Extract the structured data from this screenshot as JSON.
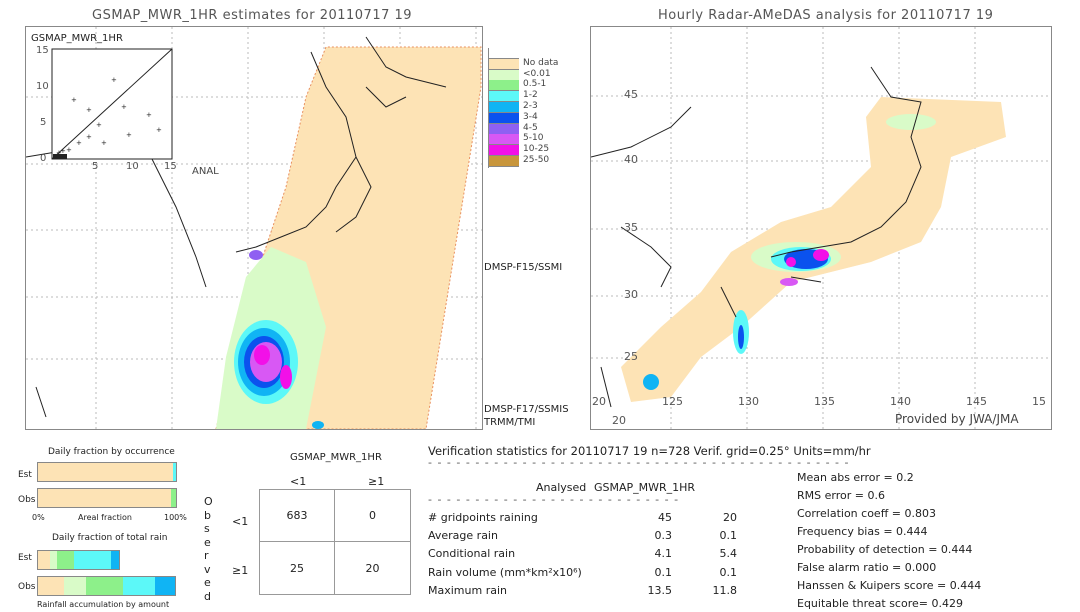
{
  "left_panel": {
    "title": "GSMAP_MWR_1HR estimates for 20110717 19",
    "inset_title": "GSMAP_MWR_1HR",
    "inset_xlabel": "ANAL",
    "inset_ticks": [
      "0",
      "5",
      "10",
      "15"
    ],
    "sensor_labels": [
      "DMSP-F15/SSMI",
      "DMSP-F17/SSMIS",
      "TRMM/TMI"
    ]
  },
  "right_panel": {
    "title": "Hourly Radar-AMeDAS analysis for 20110717 19",
    "lon_ticks": [
      "125",
      "130",
      "135",
      "140",
      "145",
      "15"
    ],
    "lat_ticks": [
      "45",
      "40",
      "35",
      "30",
      "25",
      "20"
    ],
    "corner_lon": "20",
    "corner_lat": "20",
    "credit": "Provided by JWA/JMA"
  },
  "legend": [
    {
      "label": "",
      "color": "#ffffff"
    },
    {
      "label": "No data",
      "color": "#fde3b5"
    },
    {
      "label": "<0.01",
      "color": "#d9fbc8"
    },
    {
      "label": "0.5-1",
      "color": "#8df08a"
    },
    {
      "label": "1-2",
      "color": "#5cf8f8"
    },
    {
      "label": "2-3",
      "color": "#10b4f4"
    },
    {
      "label": "3-4",
      "color": "#0b52ee"
    },
    {
      "label": "4-5",
      "color": "#8f60f2"
    },
    {
      "label": "5-10",
      "color": "#d858f4"
    },
    {
      "label": "10-25",
      "color": "#f210e8"
    },
    {
      "label": "25-50",
      "color": "#c8963c"
    }
  ],
  "occurrence": {
    "title": "Daily fraction by occurrence",
    "est_label": "Est",
    "obs_label": "Obs",
    "x_left": "0%",
    "x_mid": "Areal fraction",
    "x_right": "100%"
  },
  "total_rain": {
    "title": "Daily fraction of total rain",
    "est_label": "Est",
    "obs_label": "Obs",
    "caption": "Rainfall accumulation by amount"
  },
  "contingency": {
    "title": "GSMAP_MWR_1HR",
    "col_labels": [
      "<1",
      "≥1"
    ],
    "row_labels": [
      "<1",
      "≥1"
    ],
    "side_label": "Observed",
    "cells": [
      [
        "683",
        "0"
      ],
      [
        "25",
        "20"
      ]
    ]
  },
  "stats": {
    "header": "Verification statistics for 20110717 19   n=728   Verif. grid=0.25°   Units=mm/hr",
    "col1": "Analysed",
    "col2": "GSMAP_MWR_1HR",
    "rows": [
      {
        "label": "# gridpoints raining",
        "a": "45",
        "b": "20"
      },
      {
        "label": "Average rain",
        "a": "0.3",
        "b": "0.1"
      },
      {
        "label": "Conditional rain",
        "a": "4.1",
        "b": "5.4"
      },
      {
        "label": "Rain volume (mm*km²x10⁶)",
        "a": "0.1",
        "b": "0.1"
      },
      {
        "label": "Maximum rain",
        "a": "13.5",
        "b": "11.8"
      }
    ],
    "scores": [
      "Mean abs error = 0.2",
      "RMS error = 0.6",
      "Correlation coeff = 0.803",
      "Frequency bias = 0.444",
      "Probability of detection = 0.444",
      "False alarm ratio = 0.000",
      "Hanssen & Kuipers score = 0.444",
      "Equitable threat score= 0.429"
    ]
  }
}
